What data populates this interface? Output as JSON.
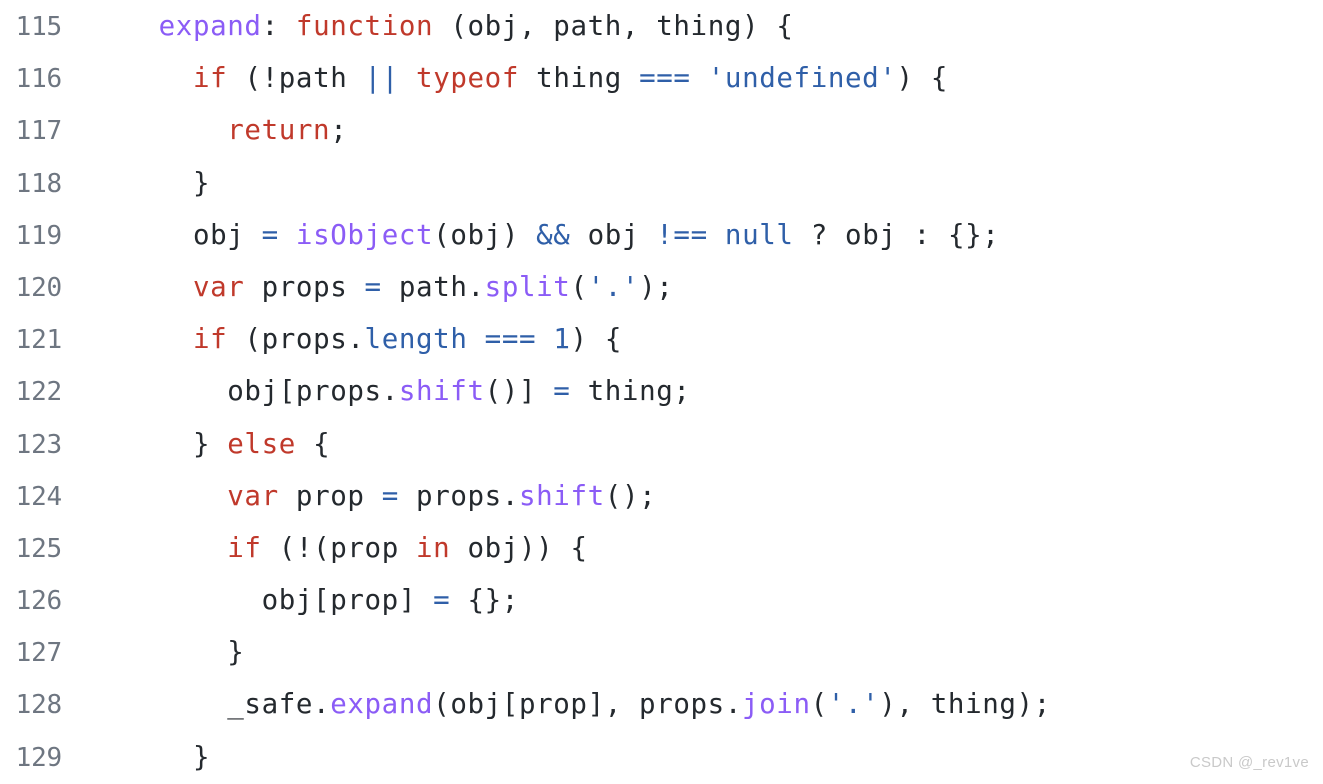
{
  "editor": {
    "language": "javascript",
    "first_line_number": 115,
    "last_line_number": 129,
    "background_color": "#ffffff",
    "gutter_color": "#6e7681",
    "colors": {
      "plain": "#24292e",
      "keyword": "#c0392b",
      "function": "#8b5cf6",
      "operator": "#2f5fa8",
      "string": "#2f5fa8",
      "number": "#2f5fa8",
      "property": "#2f5fa8",
      "constant": "#2f5fa8"
    },
    "lines": [
      {
        "number": "115",
        "text": "    expand: function (obj, path, thing) {",
        "tokens": [
          {
            "t": "    ",
            "c": "plain"
          },
          {
            "t": "expand",
            "c": "function"
          },
          {
            "t": ": ",
            "c": "plain"
          },
          {
            "t": "function",
            "c": "keyword"
          },
          {
            "t": " (obj, path, thing) {",
            "c": "plain"
          }
        ]
      },
      {
        "number": "116",
        "text": "      if (!path || typeof thing === 'undefined') {",
        "tokens": [
          {
            "t": "      ",
            "c": "plain"
          },
          {
            "t": "if",
            "c": "keyword"
          },
          {
            "t": " (!path ",
            "c": "plain"
          },
          {
            "t": "||",
            "c": "operator"
          },
          {
            "t": " ",
            "c": "plain"
          },
          {
            "t": "typeof",
            "c": "keyword"
          },
          {
            "t": " thing ",
            "c": "plain"
          },
          {
            "t": "===",
            "c": "operator"
          },
          {
            "t": " ",
            "c": "plain"
          },
          {
            "t": "'undefined'",
            "c": "string"
          },
          {
            "t": ") {",
            "c": "plain"
          }
        ]
      },
      {
        "number": "117",
        "text": "        return;",
        "tokens": [
          {
            "t": "        ",
            "c": "plain"
          },
          {
            "t": "return",
            "c": "keyword"
          },
          {
            "t": ";",
            "c": "plain"
          }
        ]
      },
      {
        "number": "118",
        "text": "      }",
        "tokens": [
          {
            "t": "      }",
            "c": "plain"
          }
        ]
      },
      {
        "number": "119",
        "text": "      obj = isObject(obj) && obj !== null ? obj : {};",
        "tokens": [
          {
            "t": "      obj ",
            "c": "plain"
          },
          {
            "t": "=",
            "c": "operator"
          },
          {
            "t": " ",
            "c": "plain"
          },
          {
            "t": "isObject",
            "c": "function"
          },
          {
            "t": "(obj) ",
            "c": "plain"
          },
          {
            "t": "&&",
            "c": "operator"
          },
          {
            "t": " obj ",
            "c": "plain"
          },
          {
            "t": "!==",
            "c": "operator"
          },
          {
            "t": " ",
            "c": "plain"
          },
          {
            "t": "null",
            "c": "constant"
          },
          {
            "t": " ? obj : {};",
            "c": "plain"
          }
        ]
      },
      {
        "number": "120",
        "text": "      var props = path.split('.');",
        "tokens": [
          {
            "t": "      ",
            "c": "plain"
          },
          {
            "t": "var",
            "c": "keyword"
          },
          {
            "t": " props ",
            "c": "plain"
          },
          {
            "t": "=",
            "c": "operator"
          },
          {
            "t": " path.",
            "c": "plain"
          },
          {
            "t": "split",
            "c": "function"
          },
          {
            "t": "(",
            "c": "plain"
          },
          {
            "t": "'.'",
            "c": "string"
          },
          {
            "t": ");",
            "c": "plain"
          }
        ]
      },
      {
        "number": "121",
        "text": "      if (props.length === 1) {",
        "tokens": [
          {
            "t": "      ",
            "c": "plain"
          },
          {
            "t": "if",
            "c": "keyword"
          },
          {
            "t": " (props.",
            "c": "plain"
          },
          {
            "t": "length",
            "c": "property"
          },
          {
            "t": " ",
            "c": "plain"
          },
          {
            "t": "===",
            "c": "operator"
          },
          {
            "t": " ",
            "c": "plain"
          },
          {
            "t": "1",
            "c": "number"
          },
          {
            "t": ") {",
            "c": "plain"
          }
        ]
      },
      {
        "number": "122",
        "text": "        obj[props.shift()] = thing;",
        "tokens": [
          {
            "t": "        obj[props.",
            "c": "plain"
          },
          {
            "t": "shift",
            "c": "function"
          },
          {
            "t": "()] ",
            "c": "plain"
          },
          {
            "t": "=",
            "c": "operator"
          },
          {
            "t": " thing;",
            "c": "plain"
          }
        ]
      },
      {
        "number": "123",
        "text": "      } else {",
        "tokens": [
          {
            "t": "      } ",
            "c": "plain"
          },
          {
            "t": "else",
            "c": "keyword"
          },
          {
            "t": " {",
            "c": "plain"
          }
        ]
      },
      {
        "number": "124",
        "text": "        var prop = props.shift();",
        "tokens": [
          {
            "t": "        ",
            "c": "plain"
          },
          {
            "t": "var",
            "c": "keyword"
          },
          {
            "t": " prop ",
            "c": "plain"
          },
          {
            "t": "=",
            "c": "operator"
          },
          {
            "t": " props.",
            "c": "plain"
          },
          {
            "t": "shift",
            "c": "function"
          },
          {
            "t": "();",
            "c": "plain"
          }
        ]
      },
      {
        "number": "125",
        "text": "        if (!(prop in obj)) {",
        "tokens": [
          {
            "t": "        ",
            "c": "plain"
          },
          {
            "t": "if",
            "c": "keyword"
          },
          {
            "t": " (!(prop ",
            "c": "plain"
          },
          {
            "t": "in",
            "c": "keyword"
          },
          {
            "t": " obj)) {",
            "c": "plain"
          }
        ]
      },
      {
        "number": "126",
        "text": "          obj[prop] = {};",
        "tokens": [
          {
            "t": "          obj[prop] ",
            "c": "plain"
          },
          {
            "t": "=",
            "c": "operator"
          },
          {
            "t": " {};",
            "c": "plain"
          }
        ]
      },
      {
        "number": "127",
        "text": "        }",
        "tokens": [
          {
            "t": "        }",
            "c": "plain"
          }
        ]
      },
      {
        "number": "128",
        "text": "        _safe.expand(obj[prop], props.join('.'), thing);",
        "tokens": [
          {
            "t": "        _safe.",
            "c": "plain"
          },
          {
            "t": "expand",
            "c": "function"
          },
          {
            "t": "(obj[prop], props.",
            "c": "plain"
          },
          {
            "t": "join",
            "c": "function"
          },
          {
            "t": "(",
            "c": "plain"
          },
          {
            "t": "'.'",
            "c": "string"
          },
          {
            "t": "), thing);",
            "c": "plain"
          }
        ]
      },
      {
        "number": "129",
        "text": "      }",
        "tokens": [
          {
            "t": "      }",
            "c": "plain"
          }
        ]
      }
    ]
  },
  "watermark": {
    "text": "CSDN @_rev1ve"
  }
}
